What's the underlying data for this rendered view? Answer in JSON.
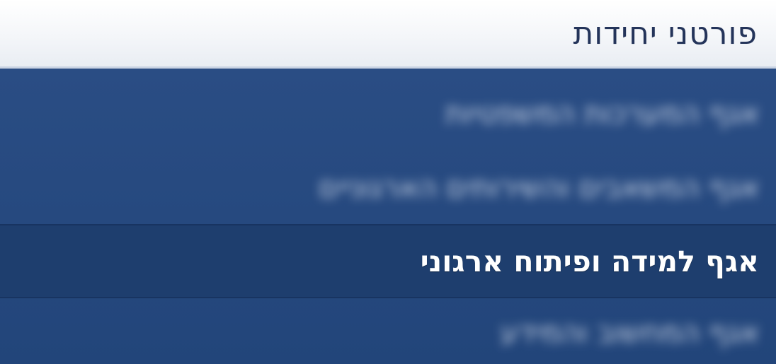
{
  "panel": {
    "title": "פורטני יחידות"
  },
  "menu": {
    "items": [
      {
        "label": "אגף המערכות המשפטיות",
        "blurred": true
      },
      {
        "label": "אגף המשאבים והשירותים הארגוניים",
        "blurred": true
      },
      {
        "label": "אגף למידה ופיתוח ארגוני",
        "blurred": false,
        "active": true
      },
      {
        "label": "אגף המחשוב והמידע",
        "blurred": true
      }
    ]
  },
  "colors": {
    "header_text": "#24345a",
    "menu_bg": "#22457a",
    "active_bg": "#1e3e6e",
    "menu_text": "#ffffff"
  }
}
